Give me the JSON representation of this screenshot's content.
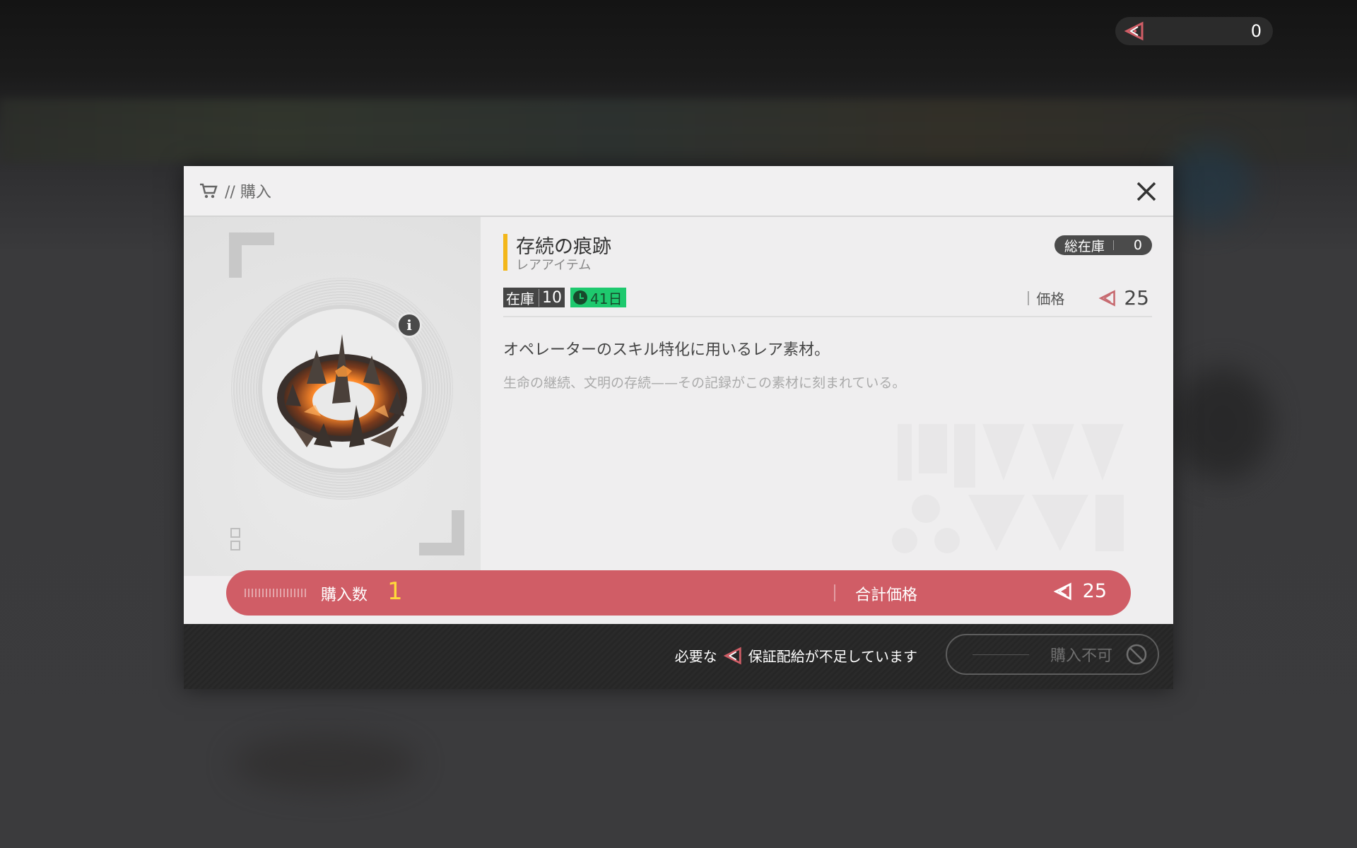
{
  "topbar": {
    "currency_icon": "warranty-token-icon",
    "currency_amount": "0"
  },
  "dialog": {
    "header": {
      "cart_icon": "cart-icon",
      "title": "// 購入"
    },
    "item": {
      "name": "存続の痕跡",
      "rarity": "レアアイテム",
      "total_stock_label": "総在庫",
      "total_stock_value": "0",
      "stock_label": "在庫",
      "stock_value": "10",
      "time_left": "41日",
      "price_label": "価格",
      "price_value": "25",
      "description": "オペレーターのスキル特化に用いるレア素材。",
      "flavor": "生命の継続、文明の存続——その記録がこの素材に刻まれている。",
      "info_label": "i"
    },
    "purchase": {
      "quantity_label": "購入数",
      "quantity_value": "1",
      "total_label": "合計価格",
      "total_value": "25"
    },
    "footer": {
      "warning_prefix": "必要な",
      "warning_suffix": "保証配給が不足しています",
      "buy_button_label": "購入不可"
    }
  },
  "colors": {
    "accent_bar": "#d05d66",
    "quantity_highlight": "#ffd93b",
    "rarity_bar": "#f3b71a",
    "time_tag": "#1ec96e"
  }
}
